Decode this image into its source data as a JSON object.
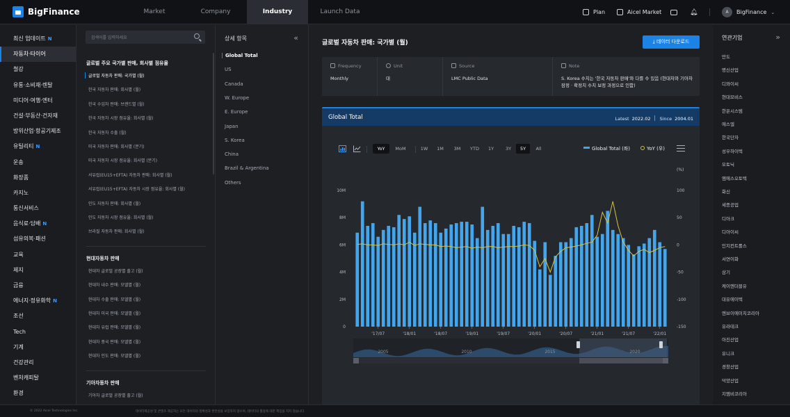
{
  "app": {
    "name": "BigFinance"
  },
  "nav": {
    "tabs": [
      "Market",
      "Company",
      "Industry",
      "Launch Data"
    ],
    "active": "Industry"
  },
  "topbar": {
    "plan": "Plan",
    "aicel_market": "Aicel Market",
    "user_initial": "A",
    "user": "BigFinance"
  },
  "sidebar": {
    "items": [
      {
        "label": "최신 업데이트",
        "badge": "N"
      },
      {
        "label": "자동차·타이어",
        "active": true
      },
      {
        "label": "철강"
      },
      {
        "label": "유통·소비재·렌탈"
      },
      {
        "label": "미디어·여행·엔터"
      },
      {
        "label": "건설·부동산·건자재"
      },
      {
        "label": "방위산업·항공기제조"
      },
      {
        "label": "유틸리티",
        "badge": "N"
      },
      {
        "label": "운송"
      },
      {
        "label": "화장품"
      },
      {
        "label": "카지노"
      },
      {
        "label": "통신서비스"
      },
      {
        "label": "음식료·담배",
        "badge": "N"
      },
      {
        "label": "섬유의복·패션"
      },
      {
        "label": "교육"
      },
      {
        "label": "제지"
      },
      {
        "label": "금융"
      },
      {
        "label": "에너지·정유화학",
        "badge": "N"
      },
      {
        "label": "조선"
      },
      {
        "label": "Tech"
      },
      {
        "label": "기계"
      },
      {
        "label": "건강관리"
      },
      {
        "label": "벤처캐피탈"
      },
      {
        "label": "환경"
      }
    ]
  },
  "reports": {
    "search_placeholder": "검색어를 입력하세요",
    "groups": [
      {
        "title": "글로벌 주요 국가별 판매, 회사별 점유율",
        "items": [
          "글로벌 자동차 판매: 국가별 (월)",
          "한국 자동차 판매: 회사별 (월)",
          "한국 수입차 판매: 브랜드별 (월)",
          "한국 자동차 시장 점유율: 회사별 (월)",
          "한국 자동차 수출 (월)",
          "미국 자동차 판매: 회사별 (분기)",
          "미국 자동차 시장 점유율: 회사별 (분기)",
          "서유럽(EU15+EFTA) 자동차 판매: 회사별 (월)",
          "서유럽(EU15+EFTA) 자동차 시장 점유율: 회사별 (월)",
          "인도 자동차 판매: 회사별 (월)",
          "인도 자동차 시장 점유율: 회사별 (월)",
          "브라질 자동차 판매: 회사별 (월)"
        ]
      },
      {
        "title": "현대자동차 판매",
        "items": [
          "현대차 글로벌 공장별 출고 (월)",
          "현대차 내수 판매: 모델별 (월)",
          "현대차 수출 판매: 모델별 (월)",
          "현대차 미국 판매: 모델별 (월)",
          "현대차 유럽 판매: 모델별 (월)",
          "현대차 중국 판매: 모델별 (월)",
          "현대차 인도 판매: 모델별 (월)"
        ]
      },
      {
        "title": "기아자동차 판매",
        "items": [
          "기아차 글로벌 공장별 출고 (월)",
          "기아차 내수 판매: 모델별 (월)"
        ]
      }
    ]
  },
  "details": {
    "title": "상세 항목",
    "items": [
      "Global Total",
      "US",
      "Canada",
      "W. Europe",
      "E. Europe",
      "Japan",
      "S. Korea",
      "China",
      "Brazil & Argentina",
      "Others"
    ]
  },
  "main": {
    "title": "글로벌 자동차 판매: 국가별 (월)",
    "download": "데이터 다운로드",
    "meta": {
      "frequency_label": "Frequency",
      "frequency": "Monthly",
      "unit_label": "Unit",
      "unit": "대",
      "source_label": "Source",
      "source": "LMC Public Data",
      "note_label": "Note",
      "note": "S. Korea 수치는 '한국 자동차 판매'와 다를 수 있음 (현대차와 기아차 잠정 · 확정치 수치 보정 과정으로 인함)"
    },
    "chart_panel": {
      "title": "Global Total",
      "latest_label": "Latest",
      "latest": "2022.02",
      "since_label": "Since",
      "since": "2004.01",
      "toolbar": {
        "modes": [
          "YoY",
          "MoM"
        ],
        "ranges": [
          "1W",
          "1M",
          "3M",
          "YTD",
          "1Y",
          "3Y",
          "5Y",
          "All"
        ],
        "active_mode": "YoY",
        "active_range": "5Y"
      }
    }
  },
  "chart_data": {
    "type": "bar",
    "x": [
      "2017-03",
      "2017-04",
      "2017-05",
      "2017-06",
      "2017-07",
      "2017-08",
      "2017-09",
      "2017-10",
      "2017-11",
      "2017-12",
      "2018-01",
      "2018-02",
      "2018-03",
      "2018-04",
      "2018-05",
      "2018-06",
      "2018-07",
      "2018-08",
      "2018-09",
      "2018-10",
      "2018-11",
      "2018-12",
      "2019-01",
      "2019-02",
      "2019-03",
      "2019-04",
      "2019-05",
      "2019-06",
      "2019-07",
      "2019-08",
      "2019-09",
      "2019-10",
      "2019-11",
      "2019-12",
      "2020-01",
      "2020-02",
      "2020-03",
      "2020-04",
      "2020-05",
      "2020-06",
      "2020-07",
      "2020-08",
      "2020-09",
      "2020-10",
      "2020-11",
      "2020-12",
      "2021-01",
      "2021-02",
      "2021-03",
      "2021-04",
      "2021-05",
      "2021-06",
      "2021-07",
      "2021-08",
      "2021-09",
      "2021-10",
      "2021-11",
      "2021-12",
      "2022-01",
      "2022-02"
    ],
    "series": [
      {
        "name": "Global Total (좌)",
        "type": "bar",
        "axis": "left",
        "color": "#43a6ec",
        "values": [
          6.9,
          9.2,
          7.4,
          7.6,
          6.6,
          7.1,
          7.4,
          7.3,
          8.2,
          7.9,
          8.1,
          6.9,
          8.8,
          7.6,
          7.8,
          7.6,
          6.9,
          7.2,
          7.5,
          7.6,
          7.7,
          7.7,
          7.5,
          6.5,
          8.8,
          7.1,
          7.4,
          7.6,
          6.8,
          6.8,
          7.4,
          7.3,
          7.7,
          7.6,
          6.3,
          4.2,
          6.2,
          3.8,
          5.2,
          6.2,
          6.2,
          6.5,
          7.3,
          7.4,
          7.6,
          8.2,
          6.6,
          6.8,
          8.5,
          7.1,
          6.8,
          6.5,
          6.0,
          5.3,
          5.9,
          6.1,
          6.5,
          7.1,
          6.2,
          5.7
        ]
      },
      {
        "name": "YoY (우)",
        "type": "line",
        "axis": "right",
        "color": "#d8c33c",
        "values": [
          1,
          2,
          0,
          0,
          -1,
          2,
          1,
          0,
          2,
          0,
          5,
          -1,
          2,
          1,
          0,
          0,
          -3,
          -2,
          -3,
          -5,
          -4,
          -3,
          -6,
          -4,
          -5,
          -3,
          -3,
          -5,
          -4,
          -3,
          -3,
          -2,
          0,
          -1,
          -10,
          -40,
          -25,
          -50,
          -22,
          -12,
          -5,
          -4,
          -2,
          0,
          3,
          5,
          18,
          60,
          40,
          80,
          35,
          5,
          -10,
          -20,
          -12,
          -8,
          -14,
          -10,
          -5,
          -3
        ]
      }
    ],
    "x_ticks": [
      "'17/07",
      "'18/01",
      "'18/07",
      "'19/01",
      "'19/07",
      "'20/01",
      "'20/07",
      "'21/01",
      "'21/07",
      "'22/01"
    ],
    "y_left": {
      "ticks": [
        "0",
        "2M",
        "4M",
        "6M",
        "8M",
        "10M"
      ],
      "range": [
        0,
        10
      ]
    },
    "y_right": {
      "label": "(%)",
      "ticks": [
        "100",
        "50",
        "0",
        "-50",
        "-100",
        "-150"
      ],
      "range": [
        -150,
        100
      ]
    },
    "navigator_years": [
      "2005",
      "2010",
      "2015",
      "2020"
    ],
    "legend_position": "top-right",
    "grid": false
  },
  "related": {
    "title": "연관기업",
    "items": [
      "만도",
      "명신산업",
      "디와이씨",
      "현대모비스",
      "한온시스템",
      "에스엘",
      "한국단자",
      "성우하이텍",
      "모토닉",
      "엠에스오토텍",
      "화신",
      "세종공업",
      "디아크",
      "디아이씨",
      "인지컨트롤스",
      "서연이화",
      "삼기",
      "케이엔더블유",
      "대유에이텍",
      "엔브이에이치코리아",
      "유라테크",
      "아진산업",
      "유니크",
      "경창산업",
      "덕양산업",
      "지엠비코리아"
    ]
  },
  "footer": {
    "copyright": "© 2022 Aicel Technologies Inc.",
    "disclaimer": "데이터제공원 및 콘텐츠 제공자는 모든 데이터의 정확성과 완전성을 보장하지 않으며, 데이터의 활용에 대한 책임을 지지 않습니다."
  }
}
